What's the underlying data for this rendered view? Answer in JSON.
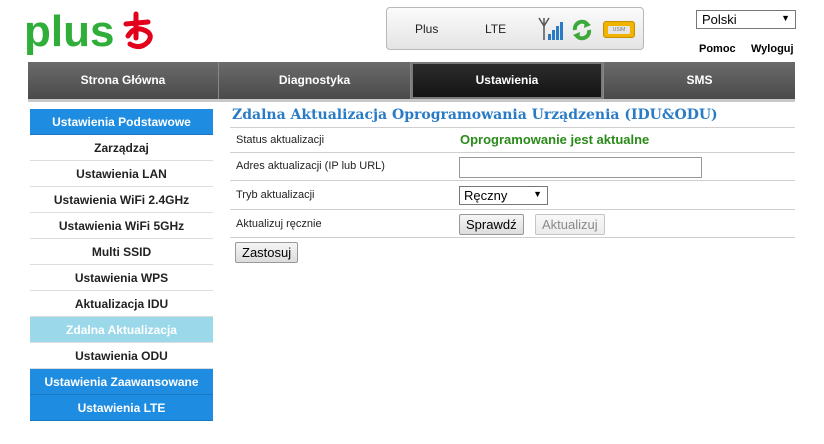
{
  "brand": {
    "logo_text": "plus",
    "accent": "#2fae3a",
    "mark_color": "#e2001a"
  },
  "status": {
    "operator": "Plus",
    "network": "LTE",
    "sim_label": "USIM"
  },
  "language": {
    "selected": "Polski"
  },
  "top_links": {
    "help": "Pomoc",
    "logout": "Wyloguj"
  },
  "nav": {
    "tabs": [
      {
        "label": "Strona Główna"
      },
      {
        "label": "Diagnostyka"
      },
      {
        "label": "Ustawienia"
      },
      {
        "label": "SMS"
      }
    ],
    "active": "Ustawienia"
  },
  "sidebar": {
    "items": [
      {
        "label": "Ustawienia Podstawowe"
      },
      {
        "label": "Zarządzaj"
      },
      {
        "label": "Ustawienia LAN"
      },
      {
        "label": "Ustawienia WiFi 2.4GHz"
      },
      {
        "label": "Ustawienia WiFi 5GHz"
      },
      {
        "label": "Multi SSID"
      },
      {
        "label": "Ustawienia WPS"
      },
      {
        "label": "Aktualizacja IDU"
      },
      {
        "label": "Zdalna Aktualizacja"
      },
      {
        "label": "Ustawienia ODU"
      },
      {
        "label": "Ustawienia Zaawansowane"
      },
      {
        "label": "Ustawienia LTE"
      }
    ],
    "selected": "Zdalna Aktualizacja"
  },
  "main": {
    "title": "Zdalna Aktualizacja Oprogramowania Urządzenia (IDU&ODU)",
    "rows": {
      "status_label": "Status aktualizacji",
      "status_value": "Oprogramowanie jest aktualne",
      "address_label": "Adres aktualizacji (IP lub URL)",
      "address_value": "",
      "mode_label": "Tryb aktualizacji",
      "mode_value": "Ręczny",
      "manual_label": "Aktualizuj ręcznie"
    },
    "buttons": {
      "check": "Sprawdź",
      "update": "Aktualizuj",
      "apply": "Zastosuj"
    }
  }
}
